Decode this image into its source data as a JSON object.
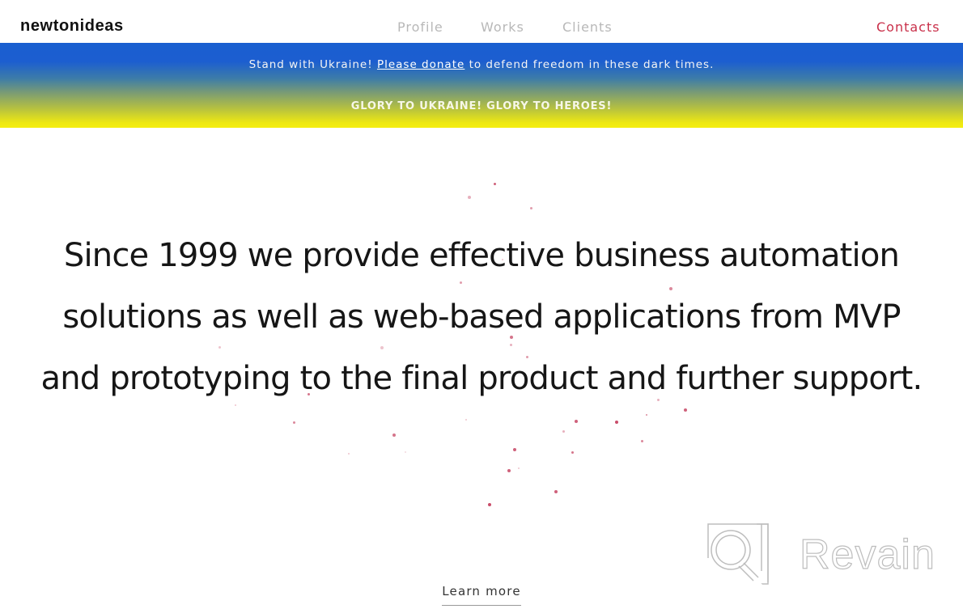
{
  "header": {
    "logo": "newtonideas",
    "nav": [
      {
        "label": "Profile"
      },
      {
        "label": "Works"
      },
      {
        "label": "Clients"
      }
    ],
    "contacts_label": "Contacts",
    "accent_color": "#c9304a"
  },
  "banner": {
    "line1_before": "Stand with Ukraine! ",
    "line1_link": "Please donate",
    "line1_after": " to defend freedom in these dark times.",
    "line2": "GLORY TO UKRAINE! GLORY TO HEROES!",
    "colors": {
      "top": "#1a5fd0",
      "bottom": "#f4ee10"
    }
  },
  "hero": {
    "lines": [
      "Since 1999 we provide effective business automation",
      "solutions as well as web-based applications from MVP",
      "and prototyping to the final product and further support."
    ]
  },
  "cta": {
    "learn_more": "Learn more"
  },
  "watermark": {
    "text": "Revain",
    "icon": "revain-logo-icon"
  }
}
